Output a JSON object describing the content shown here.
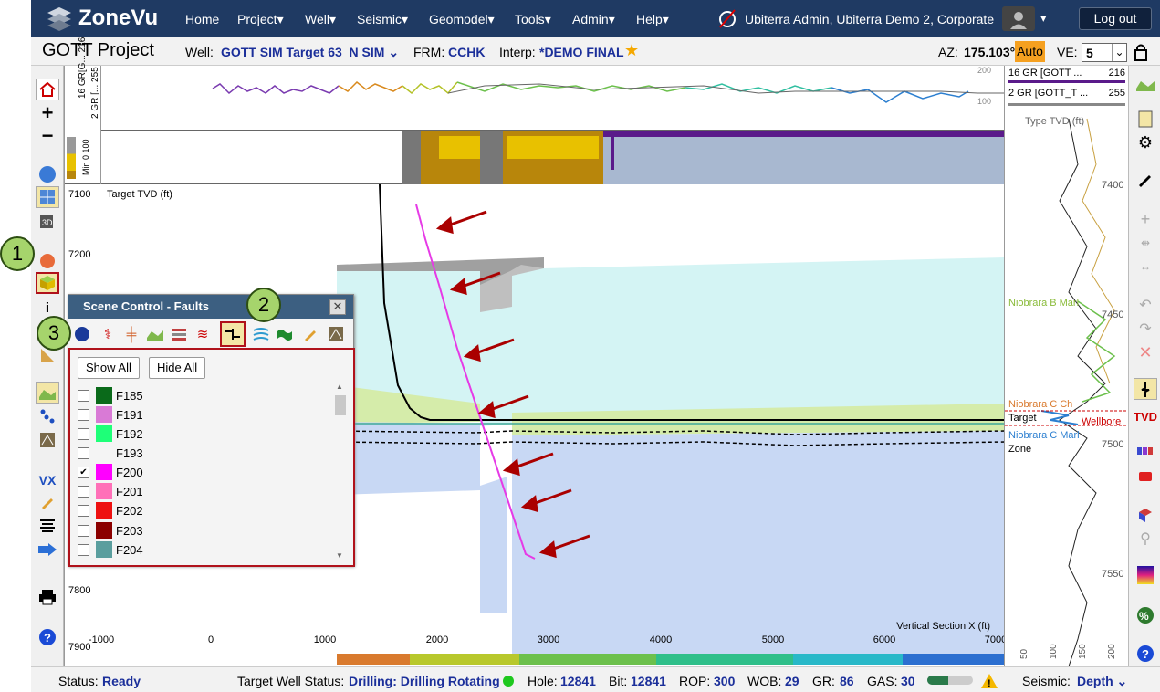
{
  "brand": {
    "name": "ZoneVu"
  },
  "nav": {
    "items": [
      "Home",
      "Project",
      "Well",
      "Seismic",
      "Geomodel",
      "Tools",
      "Admin",
      "Help"
    ]
  },
  "user": {
    "label": "Ubiterra Admin, Ubiterra Demo 2, Corporate",
    "logout": "Log out"
  },
  "header": {
    "project": "GOTT Project",
    "well_label": "Well:",
    "well_value": "GOTT SIM Target 63_N SIM",
    "frm_label": "FRM:",
    "frm_value": "CCHK",
    "interp_label": "Interp:",
    "interp_value": "*DEMO FINAL",
    "az_label": "AZ:",
    "az_value": "175.103°",
    "auto": "Auto",
    "ve_label": "VE:",
    "ve_value": "5"
  },
  "tracks": {
    "gr_label1": "16 GR[G...",
    "gr_val1": "216",
    "gr_label2": "2 GR [...",
    "gr_val2": "255",
    "scale_top": "200",
    "scale_mid": "100",
    "zone_label_a": "100",
    "zone_label_b": "Min 0"
  },
  "section": {
    "y_title": "Target TVD (ft)",
    "y_ticks": [
      "7100",
      "7200",
      "7800",
      "7900"
    ],
    "x_title": "Vertical Section X (ft)",
    "x_ticks": [
      "-1000",
      "0",
      "1000",
      "2000",
      "3000",
      "4000",
      "5000",
      "6000",
      "7000"
    ]
  },
  "type_log": {
    "header1": "16  GR [GOTT ...",
    "header1_val": "216",
    "header2": "2  GR [GOTT_T ...",
    "header2_val": "255",
    "y_title": "Type TVD (ft)",
    "ticks": [
      "7400",
      "7450",
      "7500",
      "7550"
    ],
    "labels": {
      "niobrara_b": "Niobrara B Marl",
      "niobrara_c": "Niobrara C Ch",
      "target": "Target",
      "wellbore": "Wellbore",
      "niobrara_c_marl": "Niobrara C Marl",
      "zone": "Zone"
    },
    "x_ticks": [
      "50",
      "100",
      "150",
      "200"
    ]
  },
  "panel": {
    "title": "Scene Control - Faults",
    "show_all": "Show All",
    "hide_all": "Hide All",
    "faults": [
      {
        "name": "F185",
        "color": "#0a6a1a",
        "checked": false
      },
      {
        "name": "F191",
        "color": "#d97ad6",
        "checked": false
      },
      {
        "name": "F192",
        "color": "#1eff78",
        "checked": false
      },
      {
        "name": "F193",
        "color": "",
        "checked": false
      },
      {
        "name": "F200",
        "color": "#ff00ff",
        "checked": true
      },
      {
        "name": "F201",
        "color": "#ff70b8",
        "checked": false
      },
      {
        "name": "F202",
        "color": "#ee1111",
        "checked": false
      },
      {
        "name": "F203",
        "color": "#8b0000",
        "checked": false
      },
      {
        "name": "F204",
        "color": "#5a9e9e",
        "checked": false
      }
    ]
  },
  "callouts": [
    "1",
    "2",
    "3"
  ],
  "status": {
    "status_label": "Status:",
    "status_value": "Ready",
    "target_label": "Target Well Status:",
    "target_value": "Drilling: Drilling Rotating",
    "hole_label": "Hole:",
    "hole_value": "12841",
    "bit_label": "Bit:",
    "bit_value": "12841",
    "rop_label": "ROP:",
    "rop_value": "300",
    "wob_label": "WOB:",
    "wob_value": "29",
    "gr_label": "GR:",
    "gr_value": "86",
    "gas_label": "GAS:",
    "gas_value": "30",
    "gas_level": 0.45,
    "seismic_label": "Seismic:",
    "seismic_value": "Depth"
  }
}
